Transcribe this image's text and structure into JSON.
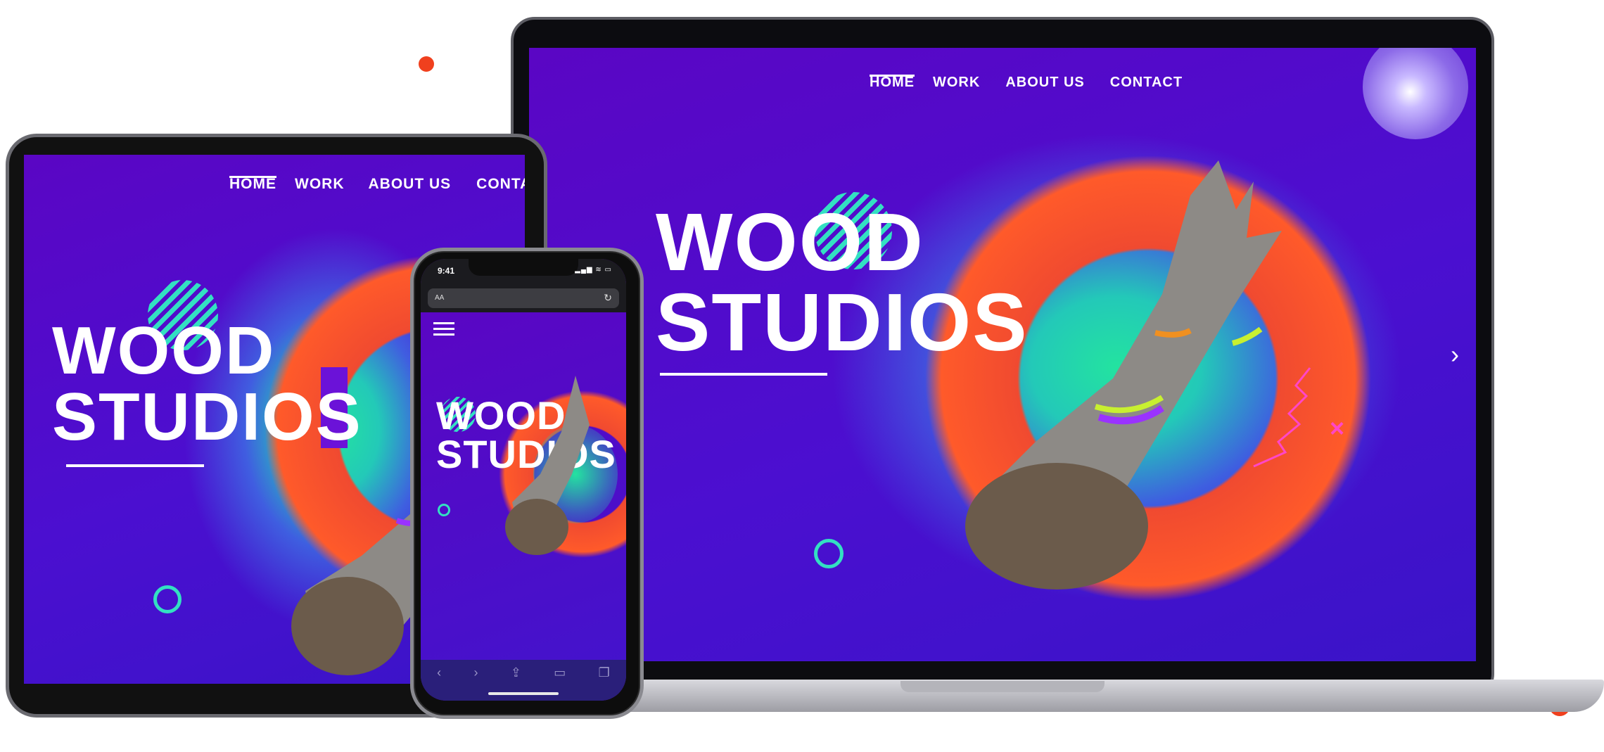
{
  "nav": {
    "home": "HOME",
    "work": "WORK",
    "about": "ABOUT US",
    "contact": "CONTACT"
  },
  "tablet_nav": {
    "home": "HOME",
    "work": "WORK",
    "about": "ABOUT US",
    "contact_truncated": "CONTA"
  },
  "hero": {
    "line1": "WOOD",
    "line2": "STUDIOS"
  },
  "phone": {
    "status_time": "9:41",
    "url_text_size": "AA",
    "status_icons": "▂▄▆ ≋ ▭"
  },
  "icons": {
    "next_slide": "chevron-right-icon",
    "decor_x": "x-mark-icon",
    "hamburger": "hamburger-menu-icon"
  },
  "colors": {
    "accent_teal": "#33e0c2",
    "purple_bg": "#5a06c4",
    "orange": "#ff5a2a",
    "decor_dot": "#f0401e"
  }
}
